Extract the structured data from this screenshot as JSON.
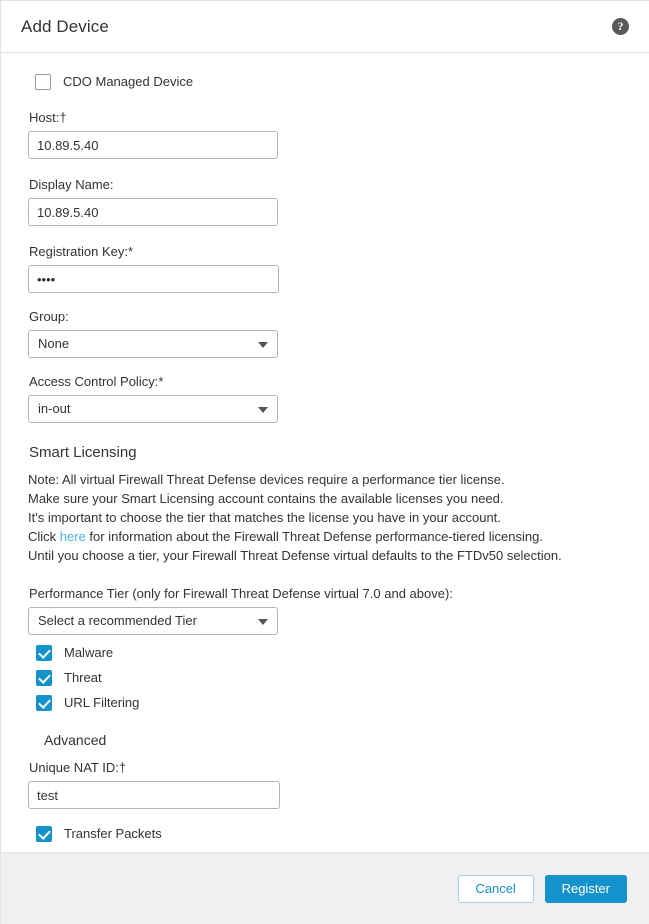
{
  "header": {
    "title": "Add Device",
    "help_icon": "help-circle-icon",
    "help_glyph": "?"
  },
  "form": {
    "cdo_managed": {
      "label": "CDO Managed Device",
      "checked": false
    },
    "host": {
      "label": "Host:†",
      "value": "10.89.5.40"
    },
    "display_name": {
      "label": "Display Name:",
      "value": "10.89.5.40"
    },
    "registration_key": {
      "label": "Registration Key:*",
      "value": "••••",
      "masked_value": "...."
    },
    "group": {
      "label": "Group:",
      "value": "None"
    },
    "access_control_policy": {
      "label": "Access Control Policy:*",
      "value": "in-out"
    }
  },
  "smart_licensing": {
    "title": "Smart Licensing",
    "note_lines": [
      "Note: All virtual Firewall Threat Defense devices require a performance tier license.",
      "Make sure your Smart Licensing account contains the available licenses you need.",
      "It's important to choose the tier that matches the license you have in your account."
    ],
    "link_line": {
      "before": "Click ",
      "link_text": "here",
      "after": " for information about the Firewall Threat Defense performance-tiered licensing."
    },
    "last_line": "Until you choose a tier, your Firewall Threat Defense virtual defaults to the FTDv50 selection.",
    "performance_tier": {
      "label": "Performance Tier (only for Firewall Threat Defense virtual 7.0 and above):",
      "value": "Select a recommended Tier"
    },
    "licenses": [
      {
        "label": "Malware",
        "checked": true
      },
      {
        "label": "Threat",
        "checked": true
      },
      {
        "label": "URL Filtering",
        "checked": true
      }
    ]
  },
  "advanced": {
    "title": "Advanced",
    "unique_nat_id": {
      "label": "Unique NAT ID:†",
      "value": "test"
    },
    "transfer_packets": {
      "label": "Transfer Packets",
      "checked": true
    }
  },
  "footer": {
    "cancel_label": "Cancel",
    "register_label": "Register"
  },
  "colors": {
    "accent_blue": "#1492cb",
    "link_blue": "#4cb4e7",
    "footer_bg": "#f0f0f0",
    "text": "#333333",
    "border": "#b4b4b4"
  }
}
